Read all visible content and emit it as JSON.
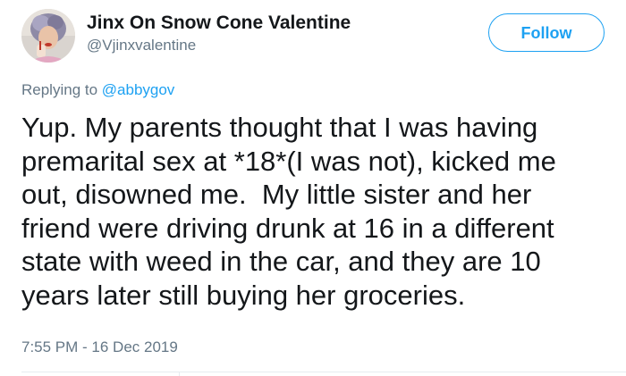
{
  "author": {
    "display_name": "Jinx On Snow Cone Valentine",
    "handle": "@Vjinxvalentine"
  },
  "follow_button": {
    "label": "Follow"
  },
  "reply": {
    "prefix": "Replying to ",
    "mention": "@abbygov"
  },
  "tweet": {
    "lines": [
      "Yup. My parents thought that I was having",
      "premarital sex at *18*(I was not), kicked me",
      "out, disowned me.  My little sister and her",
      "friend were driving drunk at 16 in a different",
      "state with weed in the car, and they are 10",
      "years later still buying her groceries."
    ],
    "timestamp": "7:55 PM - 16 Dec 2019"
  },
  "colors": {
    "accent": "#1da1f2",
    "text": "#14171a",
    "muted": "#657786"
  },
  "icons": {
    "avatar": "profile-photo"
  }
}
